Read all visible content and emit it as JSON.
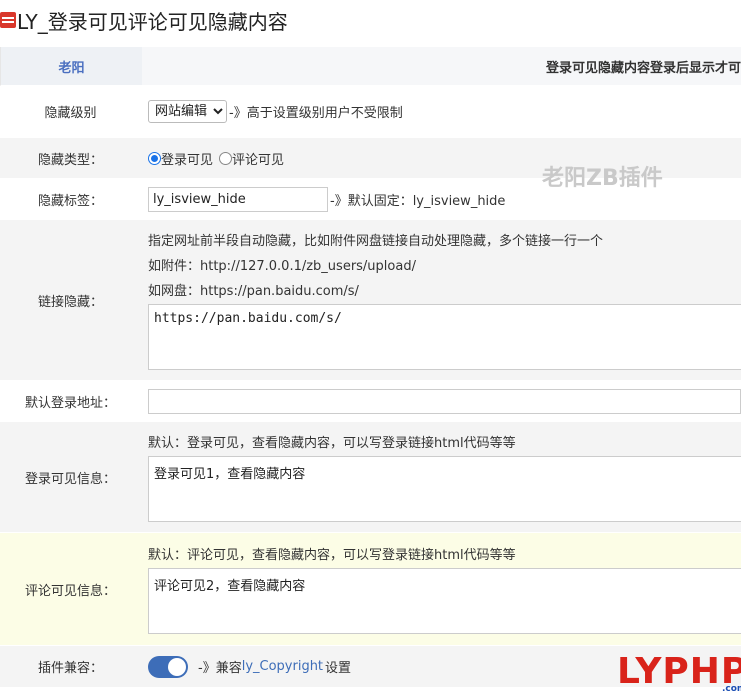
{
  "title": "LY_登录可见评论可见隐藏内容",
  "header": {
    "left": "老阳",
    "right": "登录可见隐藏内容登录后显示才可"
  },
  "rows": {
    "level": {
      "label": "隐藏级别",
      "selected": "网站编辑",
      "note": "-》高于设置级别用户不受限制"
    },
    "type": {
      "label": "隐藏类型：",
      "opt1": "登录可见",
      "opt2": "评论可见"
    },
    "tag": {
      "label": "隐藏标签：",
      "value": "ly_isview_hide",
      "note": "-》默认固定：ly_isview_hide"
    },
    "links": {
      "label": "链接隐藏：",
      "hint1": "指定网址前半段自动隐藏，比如附件网盘链接自动处理隐藏，多个链接一行一个",
      "hint2": "如附件：http://127.0.0.1/zb_users/upload/",
      "hint3": "如网盘：https://pan.baidu.com/s/",
      "value": "https://pan.baidu.com/s/"
    },
    "login_url": {
      "label": "默认登录地址：",
      "value": ""
    },
    "login_info": {
      "label": "登录可见信息：",
      "hint": "默认：登录可见，查看隐藏内容，可以写登录链接html代码等等",
      "value": "登录可见1，查看隐藏内容"
    },
    "comment_info": {
      "label": "评论可见信息：",
      "hint": "默认：评论可见，查看隐藏内容，可以写登录链接html代码等等",
      "value": "评论可见2，查看隐藏内容"
    },
    "compat": {
      "label": "插件兼容：",
      "prefix": "-》兼容 ",
      "link": "ly_Copyright",
      "suffix": " 设置"
    }
  },
  "watermark": "老阳ZB插件",
  "logo": {
    "text": "LYPHP",
    "sub": ".com"
  },
  "colors": {
    "accent": "#3d6db8",
    "logo_red": "#d9231a",
    "yellow_row": "#fcfde6"
  }
}
